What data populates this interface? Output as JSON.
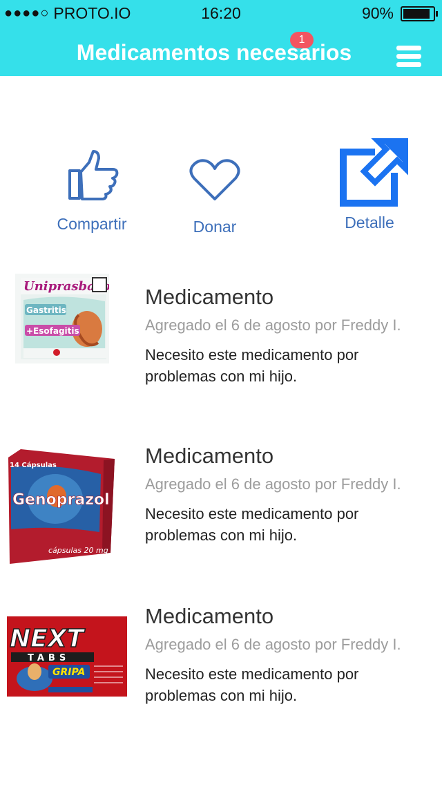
{
  "status_bar": {
    "signal": "●●●●○",
    "carrier": "PROTO.IO",
    "time": "16:20",
    "battery": "90%",
    "battery_level": 0.9
  },
  "header": {
    "title": "Medicamentos necesarios",
    "badge_count": "1",
    "menu_icon": "hamburger-menu-icon"
  },
  "actions": [
    {
      "label": "Compartir",
      "icon": "thumbs-up-icon"
    },
    {
      "label": "Donar",
      "icon": "heart-icon"
    },
    {
      "label": "Detalle",
      "icon": "external-link-icon"
    }
  ],
  "items": [
    {
      "title": "Medicamento",
      "meta": "Agregado el 6 de agosto por Freddy I.",
      "description": "Necesito este medicamento por problemas con mi hijo.",
      "image_brand": "Uniprasbazol",
      "image_text": [
        "Gastritis",
        "+Esofagitis"
      ]
    },
    {
      "title": "Medicamento",
      "meta": "Agregado el 6 de agosto por Freddy I.",
      "description": "Necesito este medicamento por problemas con mi hijo.",
      "image_brand": "Genoprazol",
      "image_text": [
        "14 Cápsulas",
        "cápsulas 20 mg"
      ]
    },
    {
      "title": "Medicamento",
      "meta": "Agregado el 6 de agosto por Freddy I.",
      "description": "Necesito este medicamento por problemas con mi hijo.",
      "image_brand": "NEXT",
      "image_text": [
        "TABS",
        "GRIPA"
      ]
    }
  ]
}
